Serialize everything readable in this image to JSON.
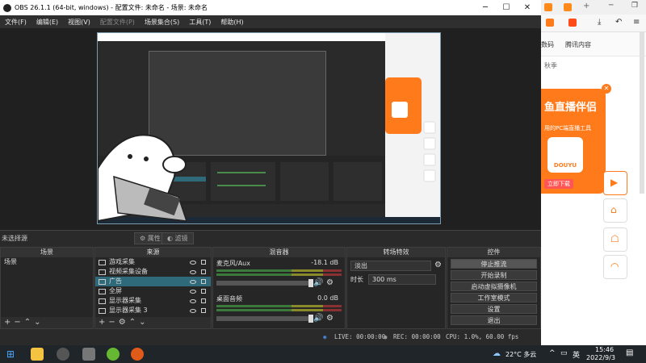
{
  "obs": {
    "title": "OBS 26.1.1 (64-bit, windows) - 配置文件: 未命名 - 场景: 未命名",
    "menu": [
      "文件(F)",
      "编辑(E)",
      "视图(V)",
      "配置文件(P)",
      "场景集合(S)",
      "工具(T)",
      "帮助(H)"
    ],
    "modebar": {
      "no_source": "未选择源",
      "properties": "属性",
      "filters": "滤镜"
    },
    "docks": {
      "scenes": {
        "title": "场景",
        "items": [
          "场景"
        ]
      },
      "sources": {
        "title": "来源",
        "items": [
          "游戏采集",
          "视频采集设备",
          "广告",
          "全屏",
          "显示器采集",
          "显示器采集 3"
        ],
        "selected_index": 2
      },
      "mixer": {
        "title": "混音器",
        "channels": [
          {
            "name": "麦克风/Aux",
            "db": "-18.1 dB"
          },
          {
            "name": "桌面音频",
            "db": "0.0 dB"
          }
        ]
      },
      "transitions": {
        "title": "转场特效",
        "type": "淡出",
        "duration_label": "时长",
        "duration_value": "300 ms"
      },
      "controls": {
        "title": "控件",
        "buttons": [
          "停止推流",
          "开始录制",
          "启动虚拟摄像机",
          "工作室模式",
          "设置",
          "退出"
        ]
      }
    },
    "status": {
      "live": "LIVE: 00:00:00",
      "rec": "REC: 00:00:00",
      "cpu": "CPU: 1.0%, 60.00 fps"
    }
  },
  "browser": {
    "ad_title": "鱼直播伴侣",
    "ad_subtitle": "用的PC端直播工具",
    "ad_logo": "DOUYU",
    "ad_button": "立即下载",
    "bookmark_text": "腾讯内容",
    "bookmark_left": "数码",
    "section_text": "秋季"
  },
  "taskbar": {
    "weather": "22°C 多云",
    "ime": "英",
    "time": "15:46",
    "date": "2022/9/3"
  }
}
